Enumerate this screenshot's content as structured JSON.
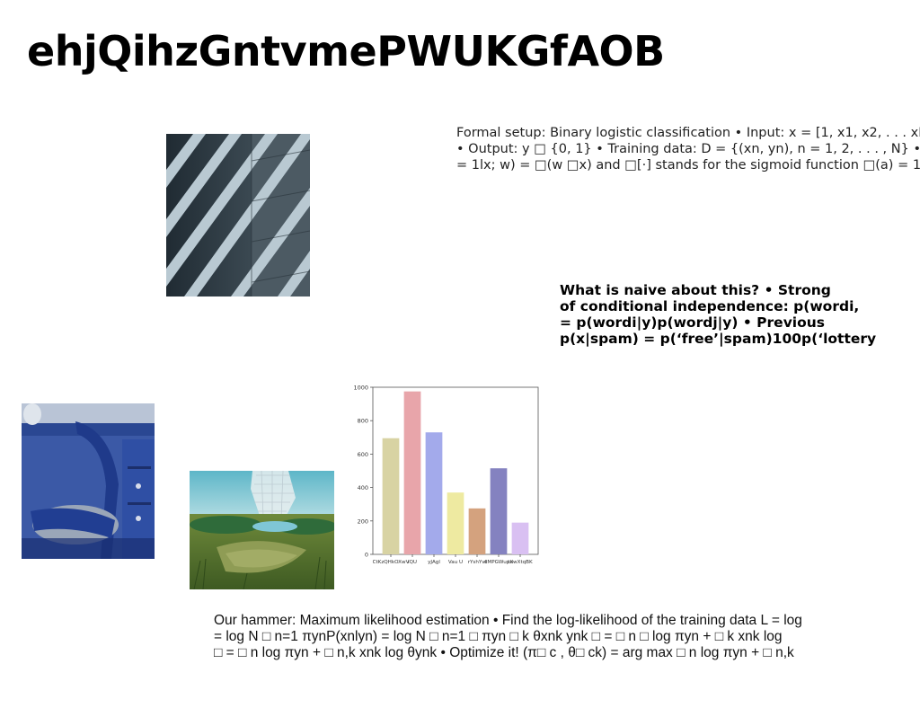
{
  "title": "ehjQihzGntvmePWUKGfAOB",
  "formal_setup": {
    "lines": [
      "Formal setup: Binary logistic classification • Input: x = [1, x1, x2, . . . xD] □",
      "• Output: y □ {0, 1} • Training data: D = {(xn, yn), n = 1, 2, . . . , N} • Model:",
      "= 1lx; w) = □(w □x) and □[·] stands for the sigmoid function □(a) = 1 1 +"
    ]
  },
  "naive": {
    "lines": [
      "What is naive about this? • Strong",
      "of conditional independence: p(wordi,",
      "= p(wordi|y)p(wordj|y) • Previous",
      "p(x|spam) = p(‘free’|spam)100p(‘lottery"
    ]
  },
  "hammer": {
    "lines": [
      "Our hammer: Maximum likelihood estimation • Find the log-likelihood of the training data L = log",
      "= log N □ n=1 πynP(xnlyn) = log N □ n=1 □ πyn □ k θxnk ynk □ = □ n □ log πyn + □ k xnk log",
      "□ = □ n log πyn + □ n,k xnk log θynk • Optimize it! (π□ c , θ□ ck) = arg max □ n log πyn + □ n,k"
    ]
  },
  "images": {
    "building": "building-facade-photo",
    "chair": "blue-chair-desk-photo",
    "landscape": "fantasy-landscape-photo"
  },
  "chart_data": {
    "type": "bar",
    "categories": [
      "CtKzQHkOXwV",
      "lQU",
      "yJAgl",
      "Vau U",
      "rYshYvI",
      "dMPGWupX",
      "tuwXtqBK"
    ],
    "values": [
      695,
      975,
      730,
      370,
      275,
      515,
      190
    ],
    "colors": [
      "#d8d3a3",
      "#e8a5aa",
      "#a3aaeb",
      "#eeeaa1",
      "#d4a27e",
      "#8482c0",
      "#d9c0f2"
    ],
    "ylim": [
      0,
      1000
    ],
    "yticks": [
      0,
      200,
      400,
      600,
      800,
      1000
    ],
    "title": "",
    "xlabel": "",
    "ylabel": "",
    "grid": false
  }
}
